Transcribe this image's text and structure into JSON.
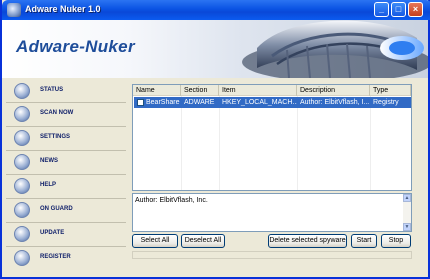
{
  "window": {
    "title": "Adware Nuker 1.0"
  },
  "banner": {
    "brand": "Adware-Nuker"
  },
  "sidebar": {
    "items": [
      {
        "label": "STATUS",
        "icon": "status-icon"
      },
      {
        "label": "SCAN NOW",
        "icon": "scan-icon"
      },
      {
        "label": "SETTINGS",
        "icon": "settings-icon"
      },
      {
        "label": "NEWS",
        "icon": "news-icon"
      },
      {
        "label": "HELP",
        "icon": "help-icon"
      },
      {
        "label": "ON GUARD",
        "icon": "guard-icon"
      },
      {
        "label": "UPDATE",
        "icon": "update-icon"
      },
      {
        "label": "REGISTER",
        "icon": "register-icon"
      }
    ]
  },
  "table": {
    "columns": [
      "Name",
      "Section",
      "Item",
      "Description",
      "Type"
    ],
    "rows": [
      {
        "name": "BearShare",
        "section": "ADWARE",
        "item": "HKEY_LOCAL_MACH...",
        "description": "Author: ElbitVflash, I...",
        "type": "Registry",
        "checked": false,
        "selected": true
      }
    ]
  },
  "details": {
    "text": "Author: ElbitVflash, Inc."
  },
  "buttons": {
    "select_all": "Select All",
    "deselect_all": "Deselect All",
    "delete_selected": "Delete selected spyware",
    "start": "Start",
    "stop": "Stop"
  },
  "colors": {
    "title_bar": "#0a53e3",
    "selection": "#316ac5",
    "brand_text": "#1e4d9a"
  }
}
